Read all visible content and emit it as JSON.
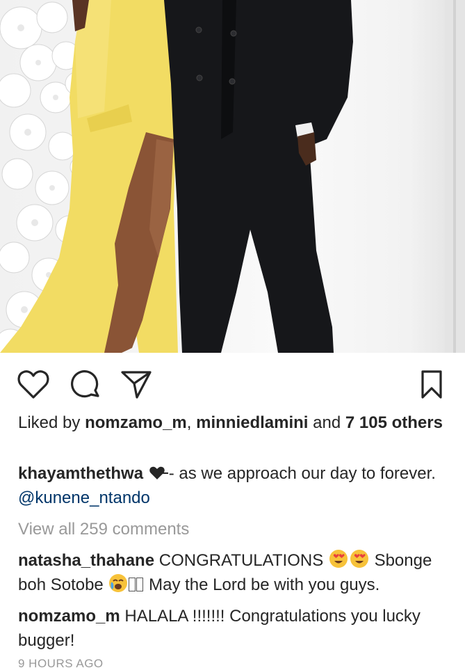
{
  "post": {
    "image_alt": "Couple posing: woman in a yellow gown, man in a black double-breasted suit, white flower wall in background"
  },
  "actions": {
    "like_icon": "heart-outline-icon",
    "comment_icon": "speech-bubble-icon",
    "share_icon": "paper-plane-icon",
    "save_icon": "bookmark-icon"
  },
  "likes": {
    "prefix": "Liked by ",
    "user1": "nomzamo_m",
    "separator": ", ",
    "user2": "minniedlamini",
    "and": " and ",
    "count": "7 105",
    "others": "others"
  },
  "caption": {
    "username": "khayamthethwa",
    "text": "- as we approach our day to forever. ",
    "mention": "@kunene_ntando"
  },
  "view_all_comments": "View all 259 comments",
  "comments": [
    {
      "username": "natasha_thahane",
      "text_a": "CONGRATULATIONS",
      "text_b": "Sbonge boh Sotobe",
      "text_c": "May the Lord be with you guys."
    },
    {
      "username": "nomzamo_m",
      "text": "HALALA !!!!!!! Congratulations you lucky bugger!"
    }
  ],
  "timestamp": "9 HOURS AGO",
  "colors": {
    "text": "#262626",
    "muted": "#999999",
    "mention": "#003569",
    "dress": "#f2dc63",
    "suit": "#16171a"
  }
}
